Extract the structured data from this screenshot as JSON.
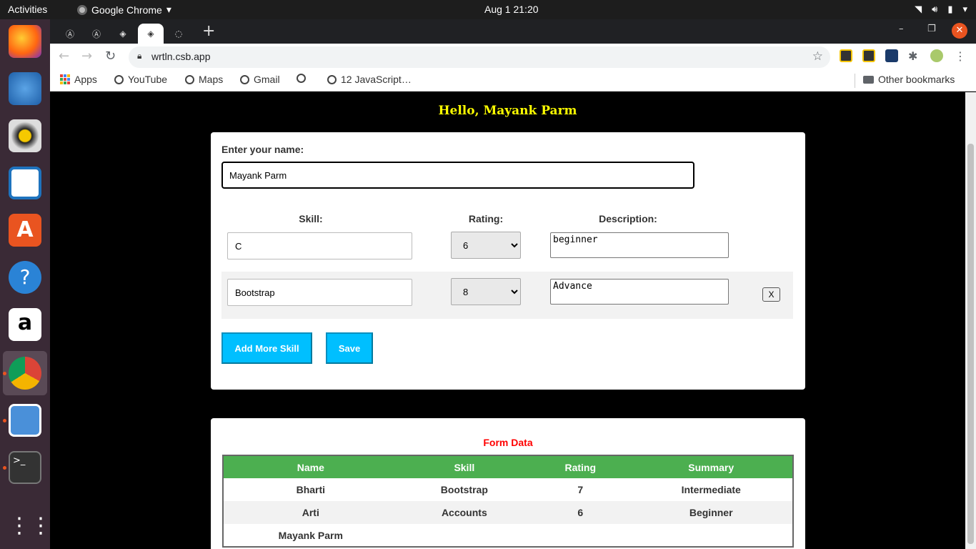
{
  "topbar": {
    "activities": "Activities",
    "app_name": "Google Chrome",
    "clock": "Aug 1  21:20"
  },
  "browser": {
    "url": "wrtln.csb.app",
    "bookmarks": {
      "apps": "Apps",
      "youtube": "YouTube",
      "maps": "Maps",
      "gmail": "Gmail",
      "js": "12 JavaScript…",
      "other": "Other bookmarks"
    }
  },
  "page": {
    "greeting": "Hello, Mayank Parm",
    "name_label": "Enter your name:",
    "name_value": "Mayank Parm",
    "headers": {
      "skill": "Skill:",
      "rating": "Rating:",
      "description": "Description:"
    },
    "skills": [
      {
        "skill": "C",
        "rating": "6",
        "description": "beginner"
      },
      {
        "skill": "Bootstrap",
        "rating": "8",
        "description": "Advance",
        "remove": "X"
      }
    ],
    "add_more": "Add More Skill",
    "save": "Save",
    "form_data_title": "Form Data",
    "table": {
      "columns": [
        "Name",
        "Skill",
        "Rating",
        "Summary"
      ],
      "rows": [
        [
          "Bharti",
          "Bootstrap",
          "7",
          "Intermediate"
        ],
        [
          "Arti",
          "Accounts",
          "6",
          "Beginner"
        ],
        [
          "Mayank Parm",
          "",
          "",
          ""
        ]
      ]
    }
  }
}
